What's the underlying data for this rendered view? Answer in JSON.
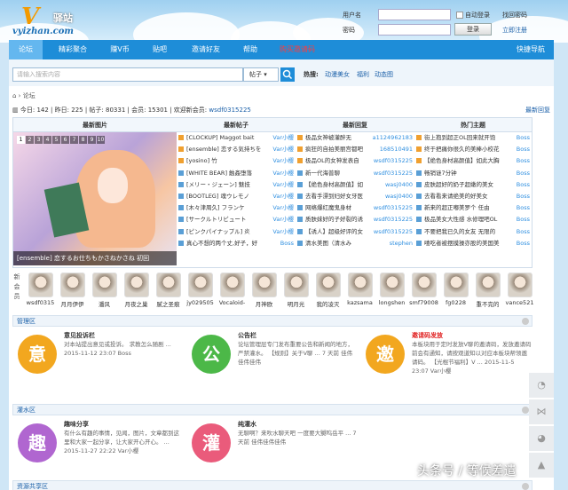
{
  "brand": {
    "name": "驿站",
    "site": "vyizhan.com"
  },
  "login": {
    "username_label": "用户名",
    "password_label": "密码",
    "remember_label": "自动登录",
    "forgot_label": "找回密码",
    "login_button": "登录",
    "register_label": "立即注册"
  },
  "nav": {
    "items": [
      "论坛",
      "精彩聚合",
      "赚V币",
      "贴吧",
      "邀请好友",
      "帮助",
      "购买邀请码"
    ],
    "quick_nav": "快捷导航"
  },
  "search": {
    "placeholder": "请输入搜索内容",
    "type": "帖子",
    "hot_label": "热搜:",
    "hot_terms": [
      "动漫美女",
      "福利",
      "动态图"
    ]
  },
  "breadcrumb": {
    "home_icon": "home-icon",
    "current": "论坛"
  },
  "stats": {
    "today_label": "今日:",
    "today": "142",
    "yesterday_label": "昨日:",
    "yesterday": "225",
    "posts_label": "帖子:",
    "posts": "80331",
    "members_label": "会员:",
    "members": "15301",
    "welcome_label": "欢迎新会员:",
    "welcome_user": "wsdf0315225",
    "new_replies": "最新回复"
  },
  "columns": {
    "pics": "最新图片",
    "posts": "最新帖子",
    "replies": "最新回复",
    "hot": "热门主题"
  },
  "slideshow": {
    "pages": [
      "1",
      "2",
      "3",
      "4",
      "5",
      "6",
      "7",
      "8",
      "9",
      "10"
    ],
    "caption": "[ensemble] 恋するお仕ちもかさねかさね 初回"
  },
  "latest_posts": [
    {
      "t": "[CLOCKUP] Maggot bait",
      "a": "Var小樱"
    },
    {
      "t": "[ensemble] 恋する気持ちを",
      "a": "Var小樱"
    },
    {
      "t": "[yosino] 竹",
      "a": "Var小樱"
    },
    {
      "t": "[WHITE BEAR] 触姦堕落",
      "a": "Var小樱"
    },
    {
      "t": "[メリー・ジェーン] 魅技",
      "a": "Var小樱"
    },
    {
      "t": "[BOOTLEG] 魂ウレモノ",
      "a": "Var小樱"
    },
    {
      "t": "[木々津周久] フランケ",
      "a": "Var小樱"
    },
    {
      "t": "[サークルトリビュート",
      "a": "Var小樱"
    },
    {
      "t": "[ピンクパイナップル] 炎",
      "a": "Var小樱"
    },
    {
      "t": "真心不想的两个丈,好子，好",
      "a": "Boss"
    }
  ],
  "latest_replies": [
    {
      "t": "极品女神被灌醉无",
      "a": "a1124962183"
    },
    {
      "t": "疯狂的自拍美丽宫都吧",
      "a": "168510491"
    },
    {
      "t": "极品OL的女神发表自",
      "a": "wsdf0315225"
    },
    {
      "t": "新一代海普聊",
      "a": "wsdf0315225"
    },
    {
      "t": "【绝色身材高颜值】如",
      "a": "wasj0400"
    },
    {
      "t": "去看手漂到妇好女牙医",
      "a": "wasj0400"
    },
    {
      "t": "网络爆红魔鬼身材",
      "a": "wsdf0315225"
    },
    {
      "t": "质肤妹好的子好裂的诱",
      "a": "wsdf0315225"
    },
    {
      "t": "【诱人】超级好评的女",
      "a": "wsdf0315225"
    },
    {
      "t": "清水美图（清水み",
      "a": "stephen"
    }
  ],
  "hot_topics": [
    {
      "t": "街上抱到超正OL回来就开饱",
      "a": "Boss"
    },
    {
      "t": "终于把痛你很久的美棒小校花",
      "a": "Boss"
    },
    {
      "t": "【绝色身材高颜值】如此大胸",
      "a": "Boss"
    },
    {
      "t": "畅销谜7分钟",
      "a": "Boss"
    },
    {
      "t": "皮肤超好的奶子超嫩的美女",
      "a": "Boss"
    },
    {
      "t": "去看看来请绝美的好美女",
      "a": "Boss"
    },
    {
      "t": "新来的超正嘟美罗个 任由",
      "a": "Boss"
    },
    {
      "t": "极品美女大性感 水修理吧OL",
      "a": "Boss"
    },
    {
      "t": "不要把我已久的女友 无限的",
      "a": "Boss"
    },
    {
      "t": "嘻吃者被摆摸操亦股的美国美",
      "a": "Boss"
    }
  ],
  "members_label": "新会员",
  "members": [
    "wsdf0315",
    "月月伊伊",
    "潘风",
    "月夜之巢",
    "腻之圣痕",
    "jy029505",
    "Vocaloid-",
    "月神欧",
    "明月光",
    "我的凌灭",
    "kazsama",
    "longshen",
    "smf79008",
    "fg0228",
    "重不完的",
    "vance521"
  ],
  "sections": [
    {
      "name": "管理区",
      "forums": [
        {
          "badge": "意",
          "title": "意见投诉栏",
          "text": "对本站提出意见或投诉。 求教怎么随剧 ... 2015-11-12 23:07 Boss",
          "color": "#f2a71f"
        },
        {
          "badge": "公",
          "title": "公告栏",
          "text": "论坛管理层专门发布重要公告和新闻的地方，严禁灌水。 【规则】关于V聊 ... 7 天前 佳伟佳伟佳伟",
          "color": "#4cb848"
        },
        {
          "badge": "邀",
          "title": "邀请码发放",
          "text": "本板块用于定时发放V聊的邀请码，发放邀请码前会有通知，请按观道知以对应本板块帮领邀请码。 【光棍节福利】V ... 2015-11-5 23:07 Var小樱",
          "color": "#f2a71f",
          "red": true
        }
      ]
    },
    {
      "name": "灌水区",
      "forums": [
        {
          "badge": "趣",
          "title": "趣味分享",
          "text": "有什么有趣的事情，见闻，图片，文章都到这里和大家一起分享，让大家开心开心。 ... 2015-11-27 22:22 Var小樱",
          "color": "#b066d0"
        },
        {
          "badge": "灌",
          "title": "纯灌水",
          "text": "无聊啊？来吹水聊天吧 一度要大嬲呜岳平 ... 7 天前 佳伟佳伟佳伟",
          "color": "#ea5b7b"
        }
      ]
    },
    {
      "name": "资源共享区",
      "forums": []
    }
  ],
  "watermark": "头条号 / 等候差遣"
}
